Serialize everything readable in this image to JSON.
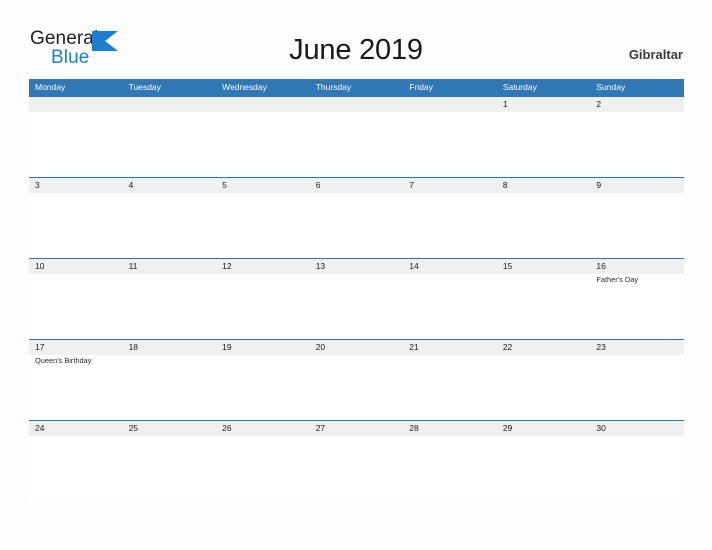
{
  "brand": {
    "word_one": "General",
    "word_two": "Blue",
    "flag_icon": "flag-triangle-icon",
    "word_one_color": "#231f20",
    "word_two_color": "#1b7fd1",
    "flag_color": "#1b7fd1"
  },
  "header": {
    "title": "June 2019",
    "region": "Gibraltar"
  },
  "theme": {
    "header_blue": "#3077b5",
    "row_rule_blue": "#2e74b5",
    "date_band_gray": "#f0f0f0",
    "page_background": "#fdfdfd",
    "text_dark": "#1a1a1a"
  },
  "calendar": {
    "weekdays": [
      "Monday",
      "Tuesday",
      "Wednesday",
      "Thursday",
      "Friday",
      "Saturday",
      "Sunday"
    ],
    "weeks": [
      {
        "days": [
          {
            "date": "",
            "event": ""
          },
          {
            "date": "",
            "event": ""
          },
          {
            "date": "",
            "event": ""
          },
          {
            "date": "",
            "event": ""
          },
          {
            "date": "",
            "event": ""
          },
          {
            "date": "1",
            "event": ""
          },
          {
            "date": "2",
            "event": ""
          }
        ]
      },
      {
        "days": [
          {
            "date": "3",
            "event": ""
          },
          {
            "date": "4",
            "event": ""
          },
          {
            "date": "5",
            "event": ""
          },
          {
            "date": "6",
            "event": ""
          },
          {
            "date": "7",
            "event": ""
          },
          {
            "date": "8",
            "event": ""
          },
          {
            "date": "9",
            "event": ""
          }
        ]
      },
      {
        "days": [
          {
            "date": "10",
            "event": ""
          },
          {
            "date": "11",
            "event": ""
          },
          {
            "date": "12",
            "event": ""
          },
          {
            "date": "13",
            "event": ""
          },
          {
            "date": "14",
            "event": ""
          },
          {
            "date": "15",
            "event": ""
          },
          {
            "date": "16",
            "event": "Father's Day"
          }
        ]
      },
      {
        "days": [
          {
            "date": "17",
            "event": "Queen's Birthday"
          },
          {
            "date": "18",
            "event": ""
          },
          {
            "date": "19",
            "event": ""
          },
          {
            "date": "20",
            "event": ""
          },
          {
            "date": "21",
            "event": ""
          },
          {
            "date": "22",
            "event": ""
          },
          {
            "date": "23",
            "event": ""
          }
        ]
      },
      {
        "days": [
          {
            "date": "24",
            "event": ""
          },
          {
            "date": "25",
            "event": ""
          },
          {
            "date": "26",
            "event": ""
          },
          {
            "date": "27",
            "event": ""
          },
          {
            "date": "28",
            "event": ""
          },
          {
            "date": "29",
            "event": ""
          },
          {
            "date": "30",
            "event": ""
          }
        ]
      }
    ]
  }
}
